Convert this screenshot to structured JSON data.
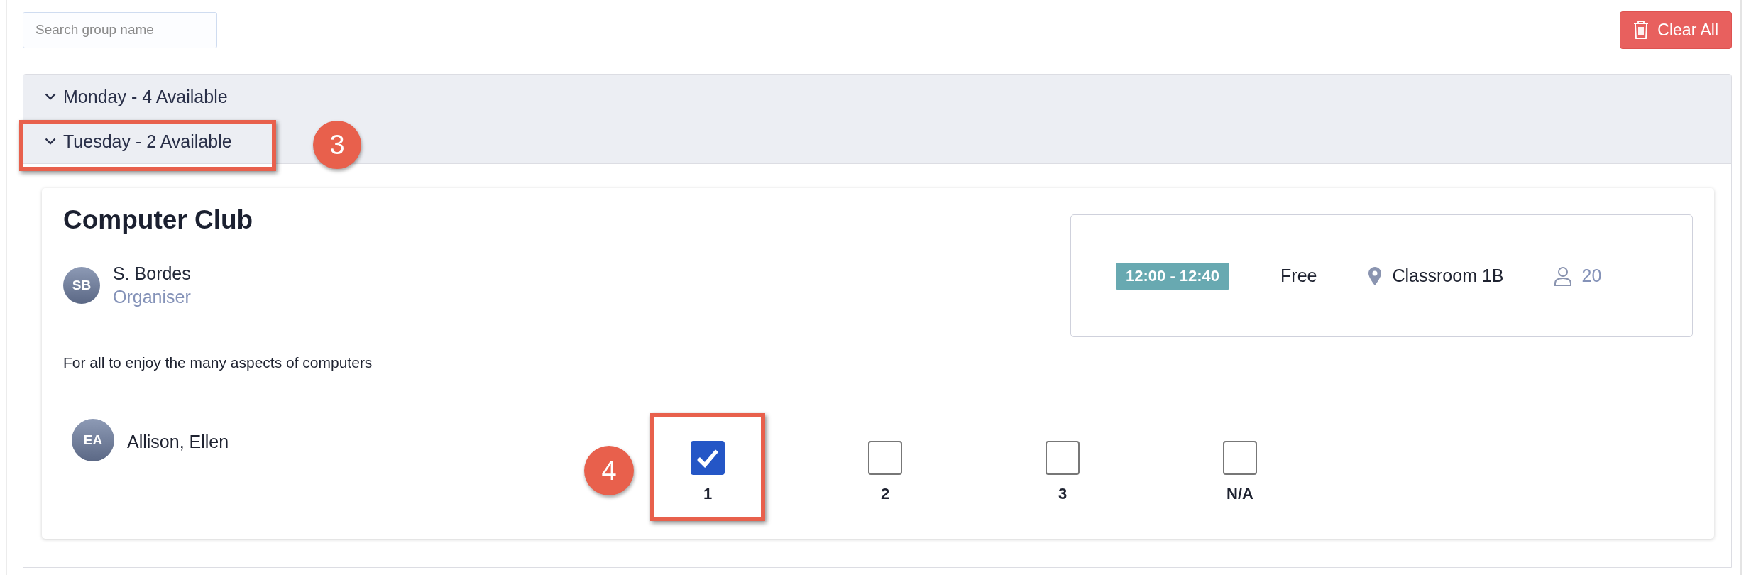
{
  "search": {
    "placeholder": "Search group name"
  },
  "clear_button": {
    "label": "Clear All"
  },
  "days": [
    {
      "label": "Monday - 4 Available"
    },
    {
      "label": "Tuesday - 2 Available",
      "annotation": "3",
      "groups": [
        {
          "title": "Computer Club",
          "organiser": {
            "initials": "SB",
            "name": "S. Bordes",
            "role": "Organiser"
          },
          "time": "12:00 - 12:40",
          "price": "Free",
          "location": "Classroom 1B",
          "capacity": "20",
          "description": "For all to enjoy the many aspects of computers",
          "participants": [
            {
              "initials": "EA",
              "name": "Allison, Ellen",
              "choices": [
                {
                  "label": "1",
                  "checked": true,
                  "annotation": "4"
                },
                {
                  "label": "2",
                  "checked": false
                },
                {
                  "label": "3",
                  "checked": false
                },
                {
                  "label": "N/A",
                  "checked": false
                }
              ]
            }
          ]
        }
      ]
    }
  ]
}
